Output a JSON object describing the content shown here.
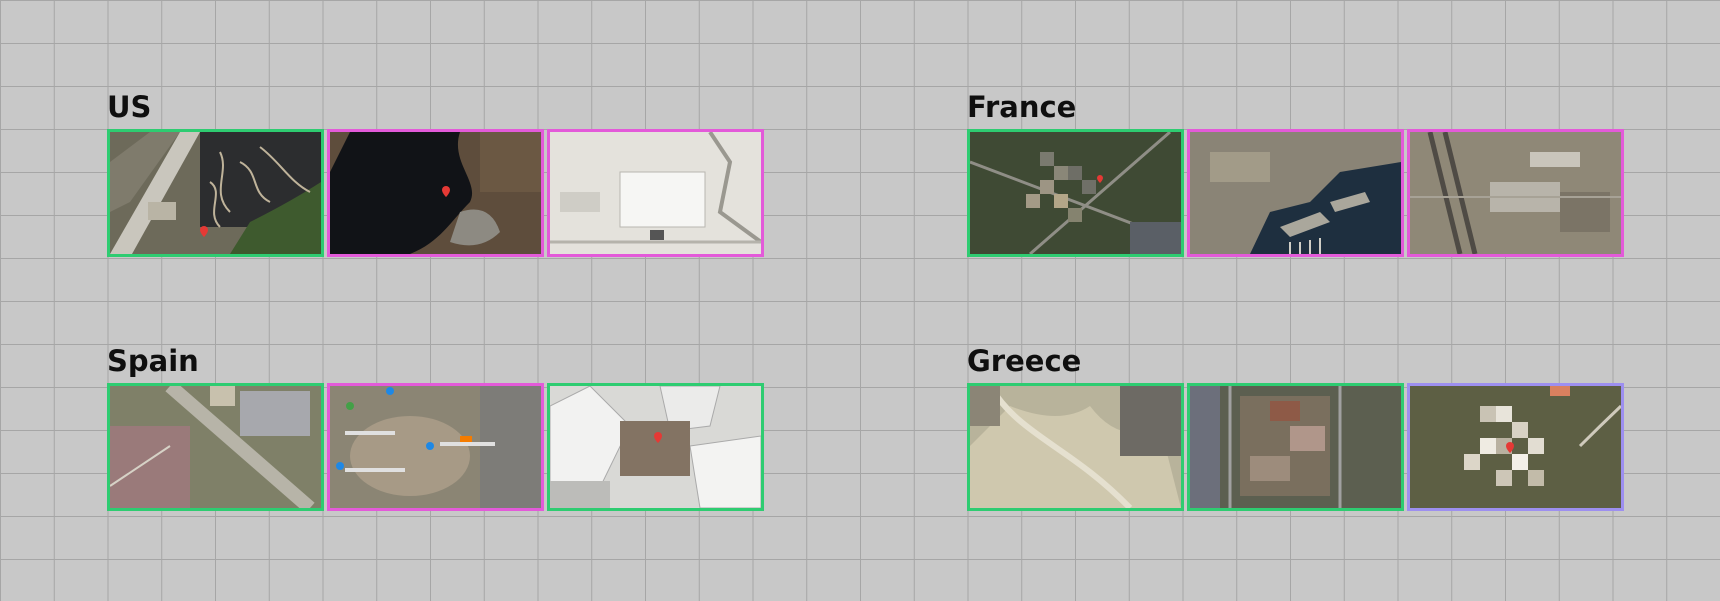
{
  "groups": [
    {
      "label": "US",
      "tiles": [
        {
          "scene": "coal-ash-pond",
          "border": "green"
        },
        {
          "scene": "dark-reservoir",
          "border": "magenta"
        },
        {
          "scene": "industrial-warehouse",
          "border": "magenta"
        }
      ]
    },
    {
      "label": "France",
      "tiles": [
        {
          "scene": "pixelated-field",
          "border": "green"
        },
        {
          "scene": "harbor-marina",
          "border": "magenta"
        },
        {
          "scene": "airfield-base",
          "border": "magenta"
        }
      ]
    },
    {
      "label": "Spain",
      "tiles": [
        {
          "scene": "suburban-airport",
          "border": "green"
        },
        {
          "scene": "blurred-map-site",
          "border": "magenta"
        },
        {
          "scene": "greenhouse-complex",
          "border": "green"
        }
      ]
    },
    {
      "label": "Greece",
      "tiles": [
        {
          "scene": "pale-hillside",
          "border": "green"
        },
        {
          "scene": "pixelated-compound",
          "border": "green"
        },
        {
          "scene": "pixelated-forest-site",
          "border": "lavender"
        }
      ]
    }
  ],
  "border_colors": {
    "green": "#2ecc71",
    "magenta": "#e35ad9",
    "lavender": "#9d8ff0"
  },
  "icons": {
    "location_pin": "map-pin-icon"
  }
}
